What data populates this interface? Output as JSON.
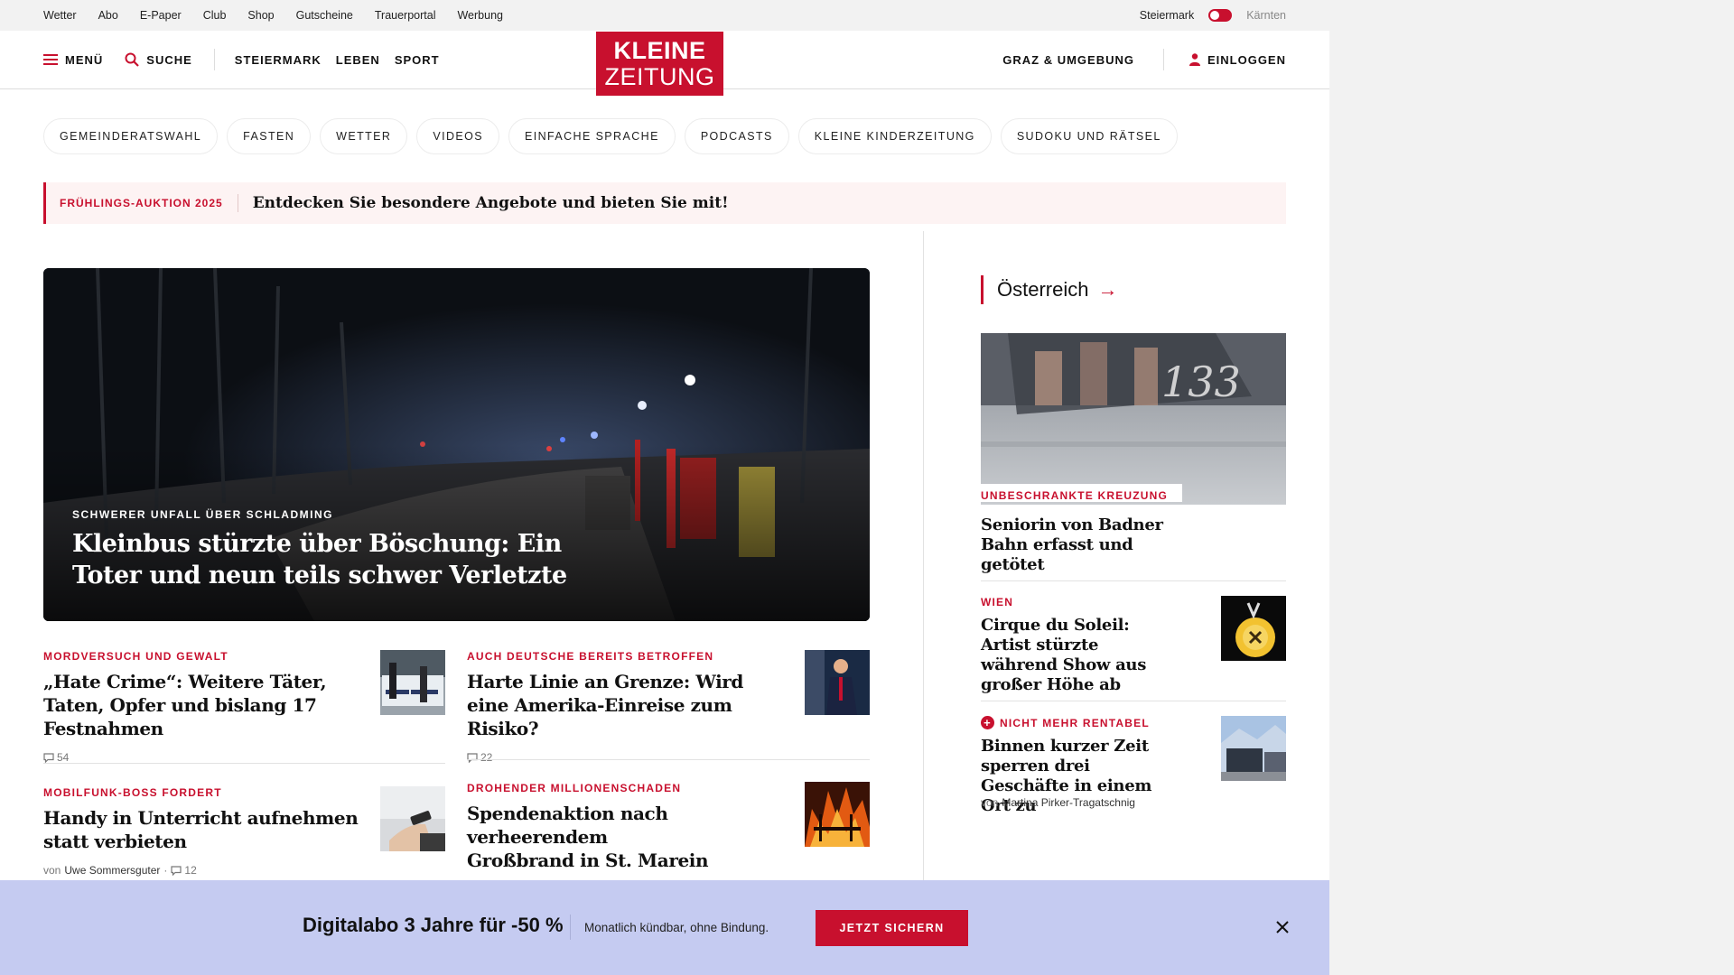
{
  "topbar": {
    "links": [
      "Wetter",
      "Abo",
      "E-Paper",
      "Club",
      "Shop",
      "Gutscheine",
      "Trauerportal",
      "Werbung"
    ],
    "region_active": "Steiermark",
    "region_other": "Kärnten"
  },
  "header": {
    "menu_label": "MENÜ",
    "search_label": "SUCHE",
    "nav": [
      "STEIERMARK",
      "LEBEN",
      "SPORT"
    ],
    "logo_line1": "KLEINE",
    "logo_line2": "ZEITUNG",
    "graz_label": "GRAZ & UMGEBUNG",
    "login_label": "EINLOGGEN"
  },
  "pills": [
    "GEMEINDERATSWAHL",
    "FASTEN",
    "WETTER",
    "VIDEOS",
    "EINFACHE SPRACHE",
    "PODCASTS",
    "KLEINE KINDERZEITUNG",
    "SUDOKU UND RÄTSEL"
  ],
  "auction": {
    "tag": "FRÜHLINGS-AUKTION 2025",
    "text": "Entdecken Sie besondere Angebote und bieten Sie mit!"
  },
  "hero": {
    "kicker": "SCHWERER UNFALL ÜBER SCHLADMING",
    "title": "Kleinbus stürzte über Böschung: Ein Toter und neun teils schwer Verletzte"
  },
  "articles": [
    {
      "kicker": "MORDVERSUCH UND GEWALT",
      "title": "„Hate Crime“: Weitere Täter, Taten, Opfer und bislang 17 Festnahmen",
      "comments": "54"
    },
    {
      "kicker": "AUCH DEUTSCHE BEREITS BETROFFEN",
      "title": "Harte Linie an Grenze: Wird eine Amerika-Einreise zum Risiko?",
      "comments": "22"
    },
    {
      "kicker": "MOBILFUNK-BOSS FORDERT",
      "title": "Handy in Unterricht aufnehmen statt verbieten",
      "by": "von",
      "author": "Uwe Sommersguter",
      "comments": "12"
    },
    {
      "kicker": "DROHENDER MILLIONENSCHADEN",
      "title": "Spendenaktion nach verheerendem Großbrand in St. Marein"
    }
  ],
  "sidebar": {
    "section": "Österreich",
    "items": [
      {
        "kicker": "UNBESCHRANKTE KREUZUNG",
        "title": "Seniorin von Badner Bahn erfasst und getötet"
      },
      {
        "kicker": "WIEN",
        "title": "Cirque du Soleil: Artist stürzte während Show aus großer Höhe ab"
      },
      {
        "kicker": "NICHT MEHR RENTABEL",
        "title": "Binnen kurzer Zeit sperren drei Geschäfte in einem Ort zu",
        "by": "von",
        "author": "Martina Pirker-Tragatschnig"
      }
    ]
  },
  "promo": {
    "headline": "Digitalabo 3 Jahre für -50 %",
    "sub": "Monatlich kündbar, ohne Bindung.",
    "button": "JETZT SICHERN"
  },
  "colors": {
    "accent": "#c8102e",
    "promo_bg": "#c5cbf1"
  }
}
